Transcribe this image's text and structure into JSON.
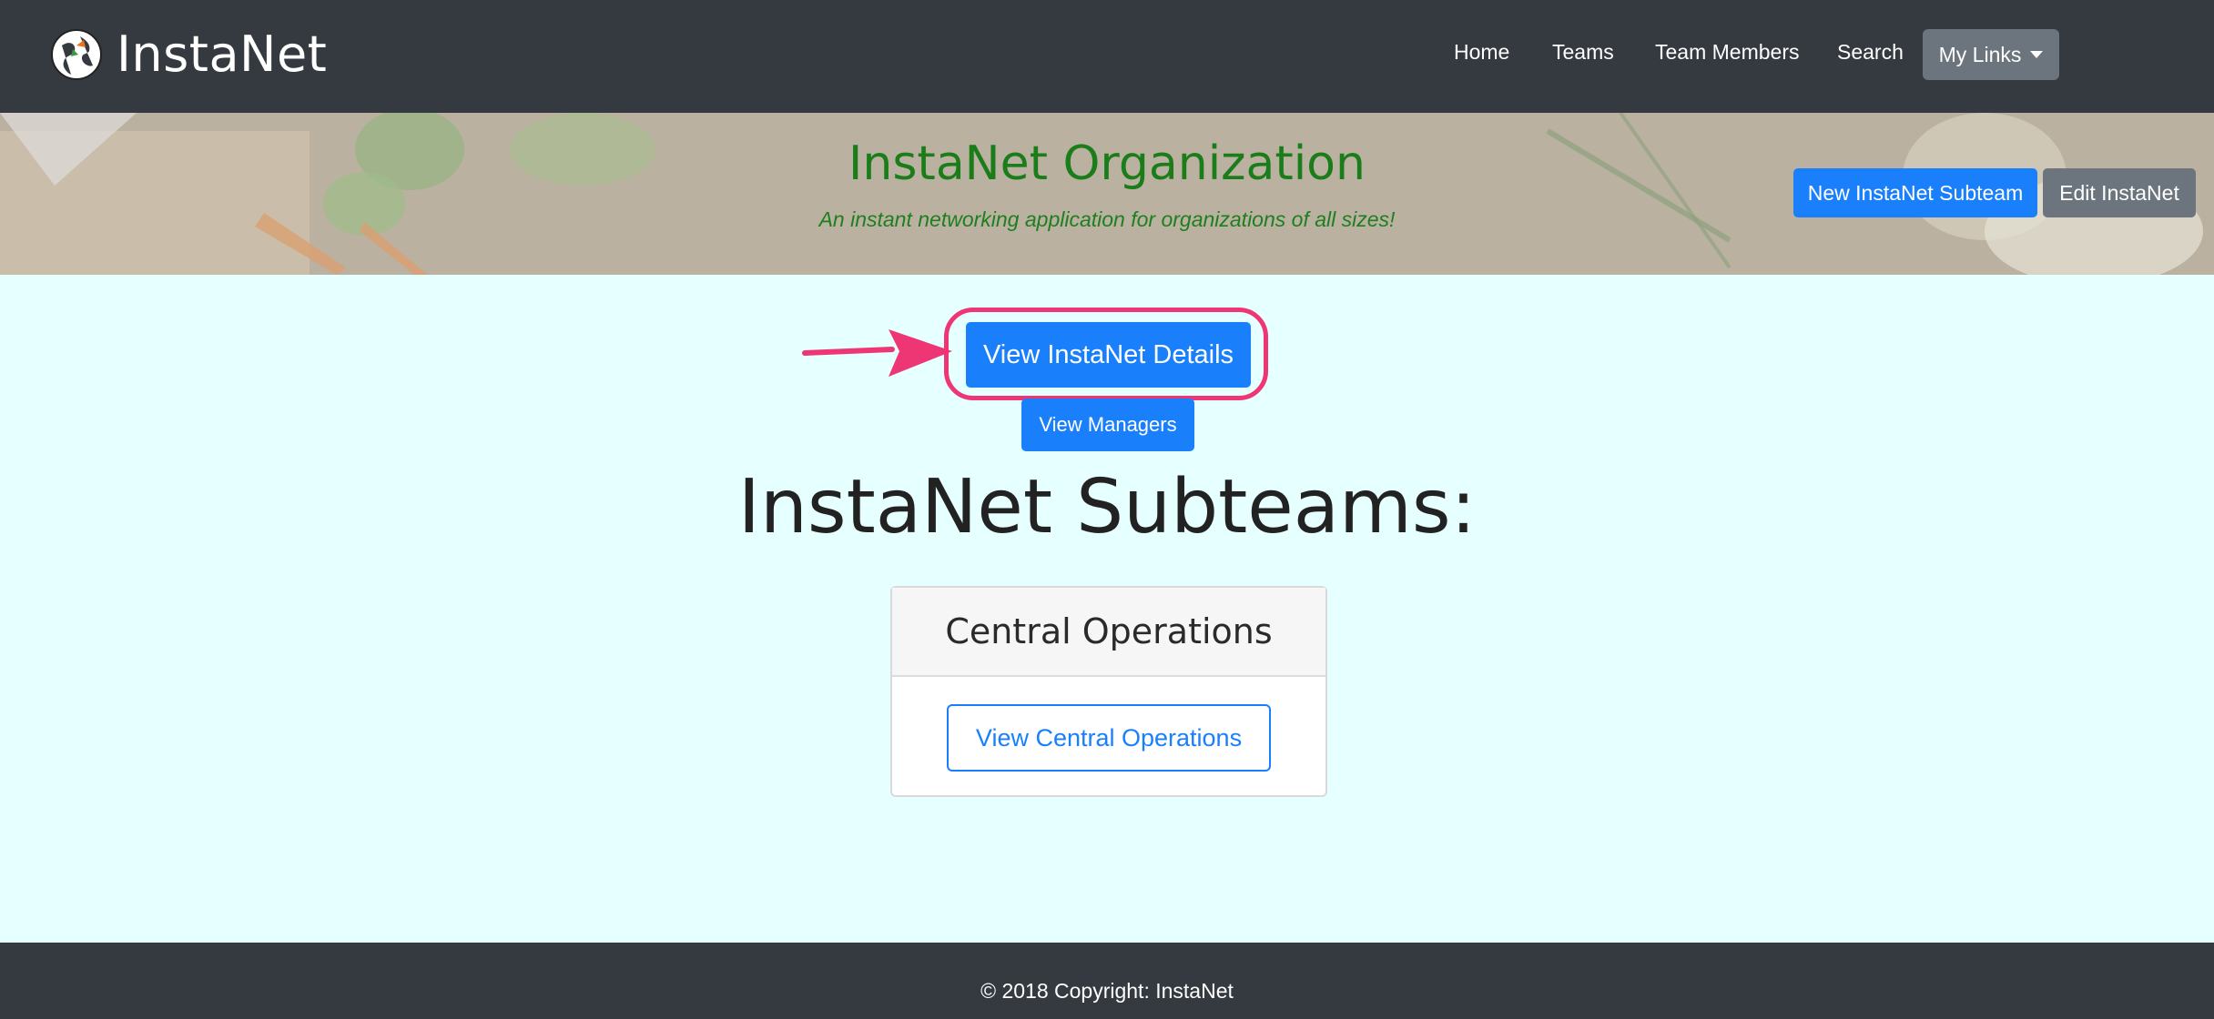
{
  "navbar": {
    "brand": "InstaNet",
    "links": [
      "Home",
      "Teams",
      "Team Members",
      "Search"
    ],
    "dropdown_label": "My Links"
  },
  "hero": {
    "title": "InstaNet Organization",
    "tagline": "An instant networking application for organizations of all sizes!",
    "new_subteam_button": "New InstaNet Subteam",
    "edit_button": "Edit InstaNet"
  },
  "main": {
    "details_button": "View InstaNet Details",
    "managers_button": "View Managers",
    "section_title": "InstaNet Subteams:",
    "cards": [
      {
        "title": "Central Operations",
        "button": "View Central Operations"
      }
    ]
  },
  "footer": {
    "copyright": "© 2018 Copyright: InstaNet"
  },
  "colors": {
    "navbar_bg": "#343a40",
    "primary": "#1a7ffb",
    "secondary": "#6c757d",
    "page_bg": "#e6ffff",
    "hero_text": "#1a7d1a",
    "annotation": "#ef3674"
  }
}
